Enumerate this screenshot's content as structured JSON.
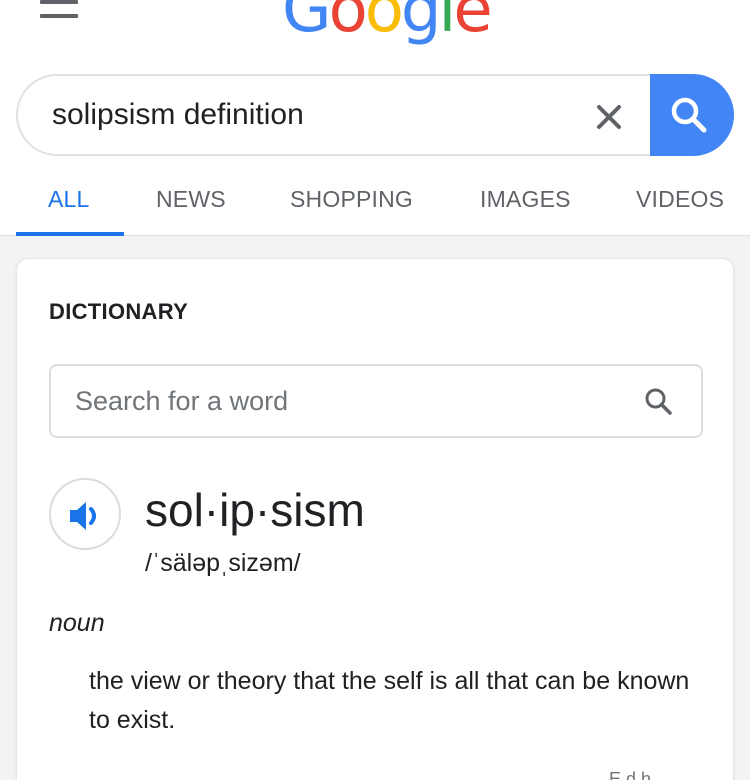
{
  "header": {
    "logo_letters": [
      {
        "char": "G",
        "color": "#4285F4"
      },
      {
        "char": "o",
        "color": "#EA4335"
      },
      {
        "char": "o",
        "color": "#FBBC05"
      },
      {
        "char": "g",
        "color": "#4285F4"
      },
      {
        "char": "l",
        "color": "#34A853"
      },
      {
        "char": "e",
        "color": "#EA4335"
      }
    ]
  },
  "search": {
    "query": "solipsism definition",
    "clear_icon": "close-icon",
    "submit_icon": "search-icon"
  },
  "tabs": [
    {
      "label": "ALL",
      "active": true
    },
    {
      "label": "NEWS",
      "active": false
    },
    {
      "label": "SHOPPING",
      "active": false
    },
    {
      "label": "IMAGES",
      "active": false
    },
    {
      "label": "VIDEOS",
      "active": false
    }
  ],
  "dictionary": {
    "heading": "DICTIONARY",
    "search_placeholder": "Search for a word",
    "headword": "sol·ip·sism",
    "pronunciation": "/ˈsäləpˌsizəm/",
    "part_of_speech": "noun",
    "definition": "the view or theory that the self is all that can be known to exist.",
    "footer_partial": "E  d  h"
  },
  "colors": {
    "accent": "#1a73e8",
    "search_button": "#4285f4"
  }
}
